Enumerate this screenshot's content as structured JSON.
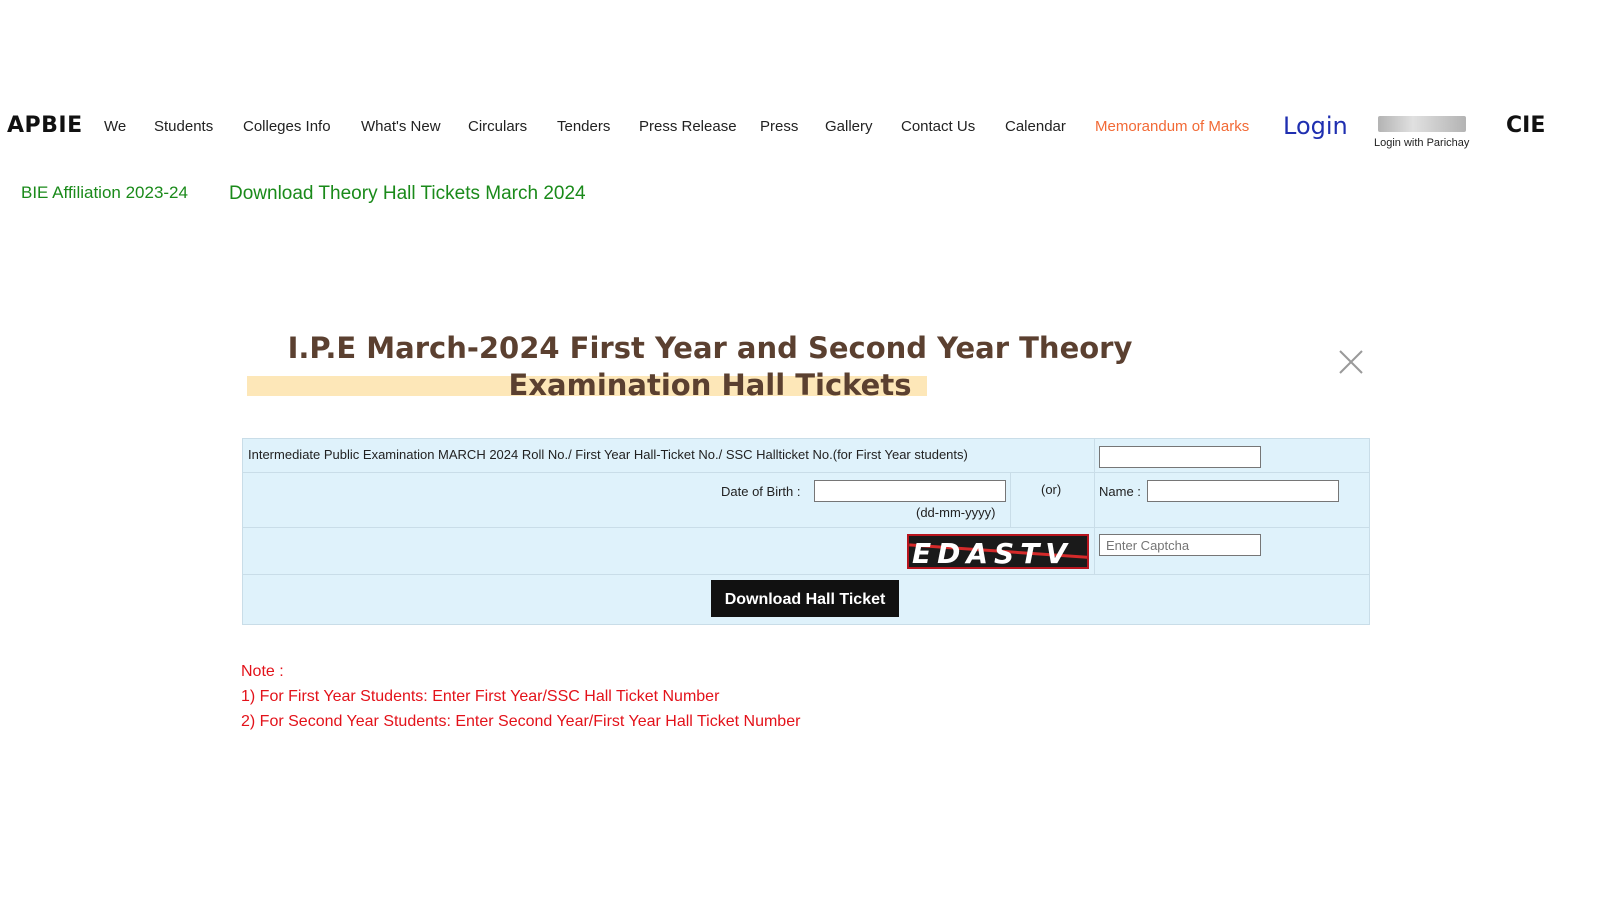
{
  "nav": {
    "brand": "APBIE",
    "items": [
      {
        "label": "We"
      },
      {
        "label": "Students"
      },
      {
        "label": "Colleges Info"
      },
      {
        "label": "What's New"
      },
      {
        "label": "Circulars"
      },
      {
        "label": "Tenders"
      },
      {
        "label": "Press Release"
      },
      {
        "label": "Press"
      },
      {
        "label": "Gallery"
      },
      {
        "label": "Contact Us"
      },
      {
        "label": "Calendar"
      },
      {
        "label": "Memorandum of Marks"
      }
    ],
    "login": "Login",
    "parichay_caption": "Login with Parichay",
    "cie": "CIE"
  },
  "sub_links": {
    "affiliation": "BIE Affiliation 2023-24",
    "hall_tickets": "Download Theory Hall Tickets March 2024"
  },
  "heading": {
    "line1": "I.P.E March-2024 First Year and Second Year Theory",
    "line2": "Examination Hall Tickets"
  },
  "form": {
    "roll_label": "Intermediate Public Examination MARCH 2024 Roll No./ First Year Hall-Ticket No./ SSC Hallticket No.(for First Year students)",
    "roll_value": "",
    "dob_label": "Date of Birth :",
    "dob_value": "",
    "dob_format": "(dd-mm-yyyy)",
    "or_text": "(or)",
    "name_label": "Name :",
    "name_value": "",
    "captcha_text": "EDASTV",
    "captcha_placeholder": "Enter Captcha",
    "submit_label": "Download Hall Ticket"
  },
  "note": {
    "title": "Note :",
    "lines": [
      "1) For First Year Students: Enter First Year/SSC Hall Ticket Number",
      "2) For Second Year Students: Enter Second Year/First Year Hall Ticket Number"
    ]
  },
  "colors": {
    "accent_orange": "#f26a36",
    "login_blue": "#1f2fb0",
    "link_green": "#1a8a1a",
    "note_red": "#e3121a",
    "form_bg": "#dff2fb",
    "heading_brown": "#5b4030",
    "heading_highlight": "#fde7b8"
  }
}
